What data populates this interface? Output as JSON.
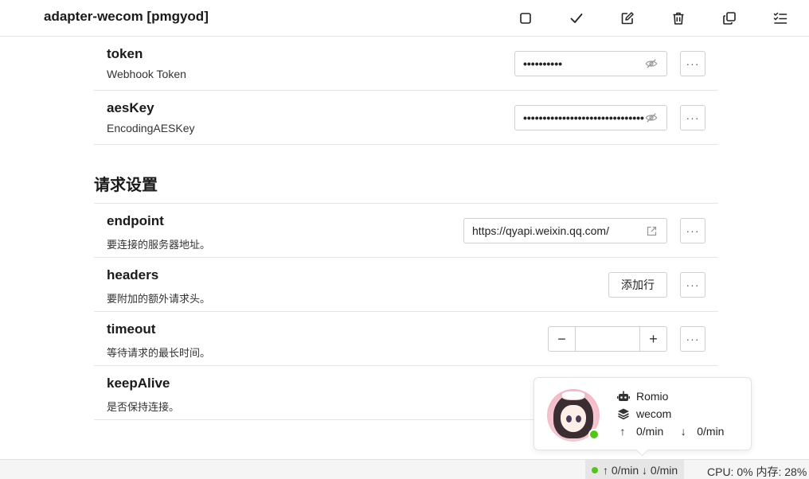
{
  "header": {
    "title": "adapter-wecom [pmgyod]",
    "tools": [
      {
        "icon": "square-icon"
      },
      {
        "icon": "check-icon"
      },
      {
        "icon": "edit-icon"
      },
      {
        "icon": "trash-icon"
      },
      {
        "icon": "copy-icon"
      },
      {
        "icon": "checklist-icon"
      }
    ]
  },
  "fields": {
    "token": {
      "name": "token",
      "desc": "Webhook Token",
      "value": "••••••••••"
    },
    "aesKey": {
      "name": "aesKey",
      "desc": "EncodingAESKey",
      "value": "•••••••••••••••••••••••••••••••••••••••••••"
    }
  },
  "section": {
    "title": "请求设置"
  },
  "request": {
    "endpoint": {
      "name": "endpoint",
      "desc": "要连接的服务器地址。",
      "value": "https://qyapi.weixin.qq.com/"
    },
    "headers": {
      "name": "headers",
      "desc": "要附加的额外请求头。",
      "button": "添加行"
    },
    "timeout": {
      "name": "timeout",
      "desc": "等待请求的最长时间。",
      "value": "",
      "minus": "−",
      "plus": "+"
    },
    "keepAlive": {
      "name": "keepAlive",
      "desc": "是否保持连接。"
    }
  },
  "more_label": "···",
  "bot": {
    "name": "Romio",
    "platform": "wecom",
    "up_rate": "0/min",
    "down_rate": "0/min",
    "status_color": "#52c41a"
  },
  "status": {
    "net": "↑ 0/min ↓ 0/min",
    "cpu": "CPU: 0% 内存: 28%"
  }
}
